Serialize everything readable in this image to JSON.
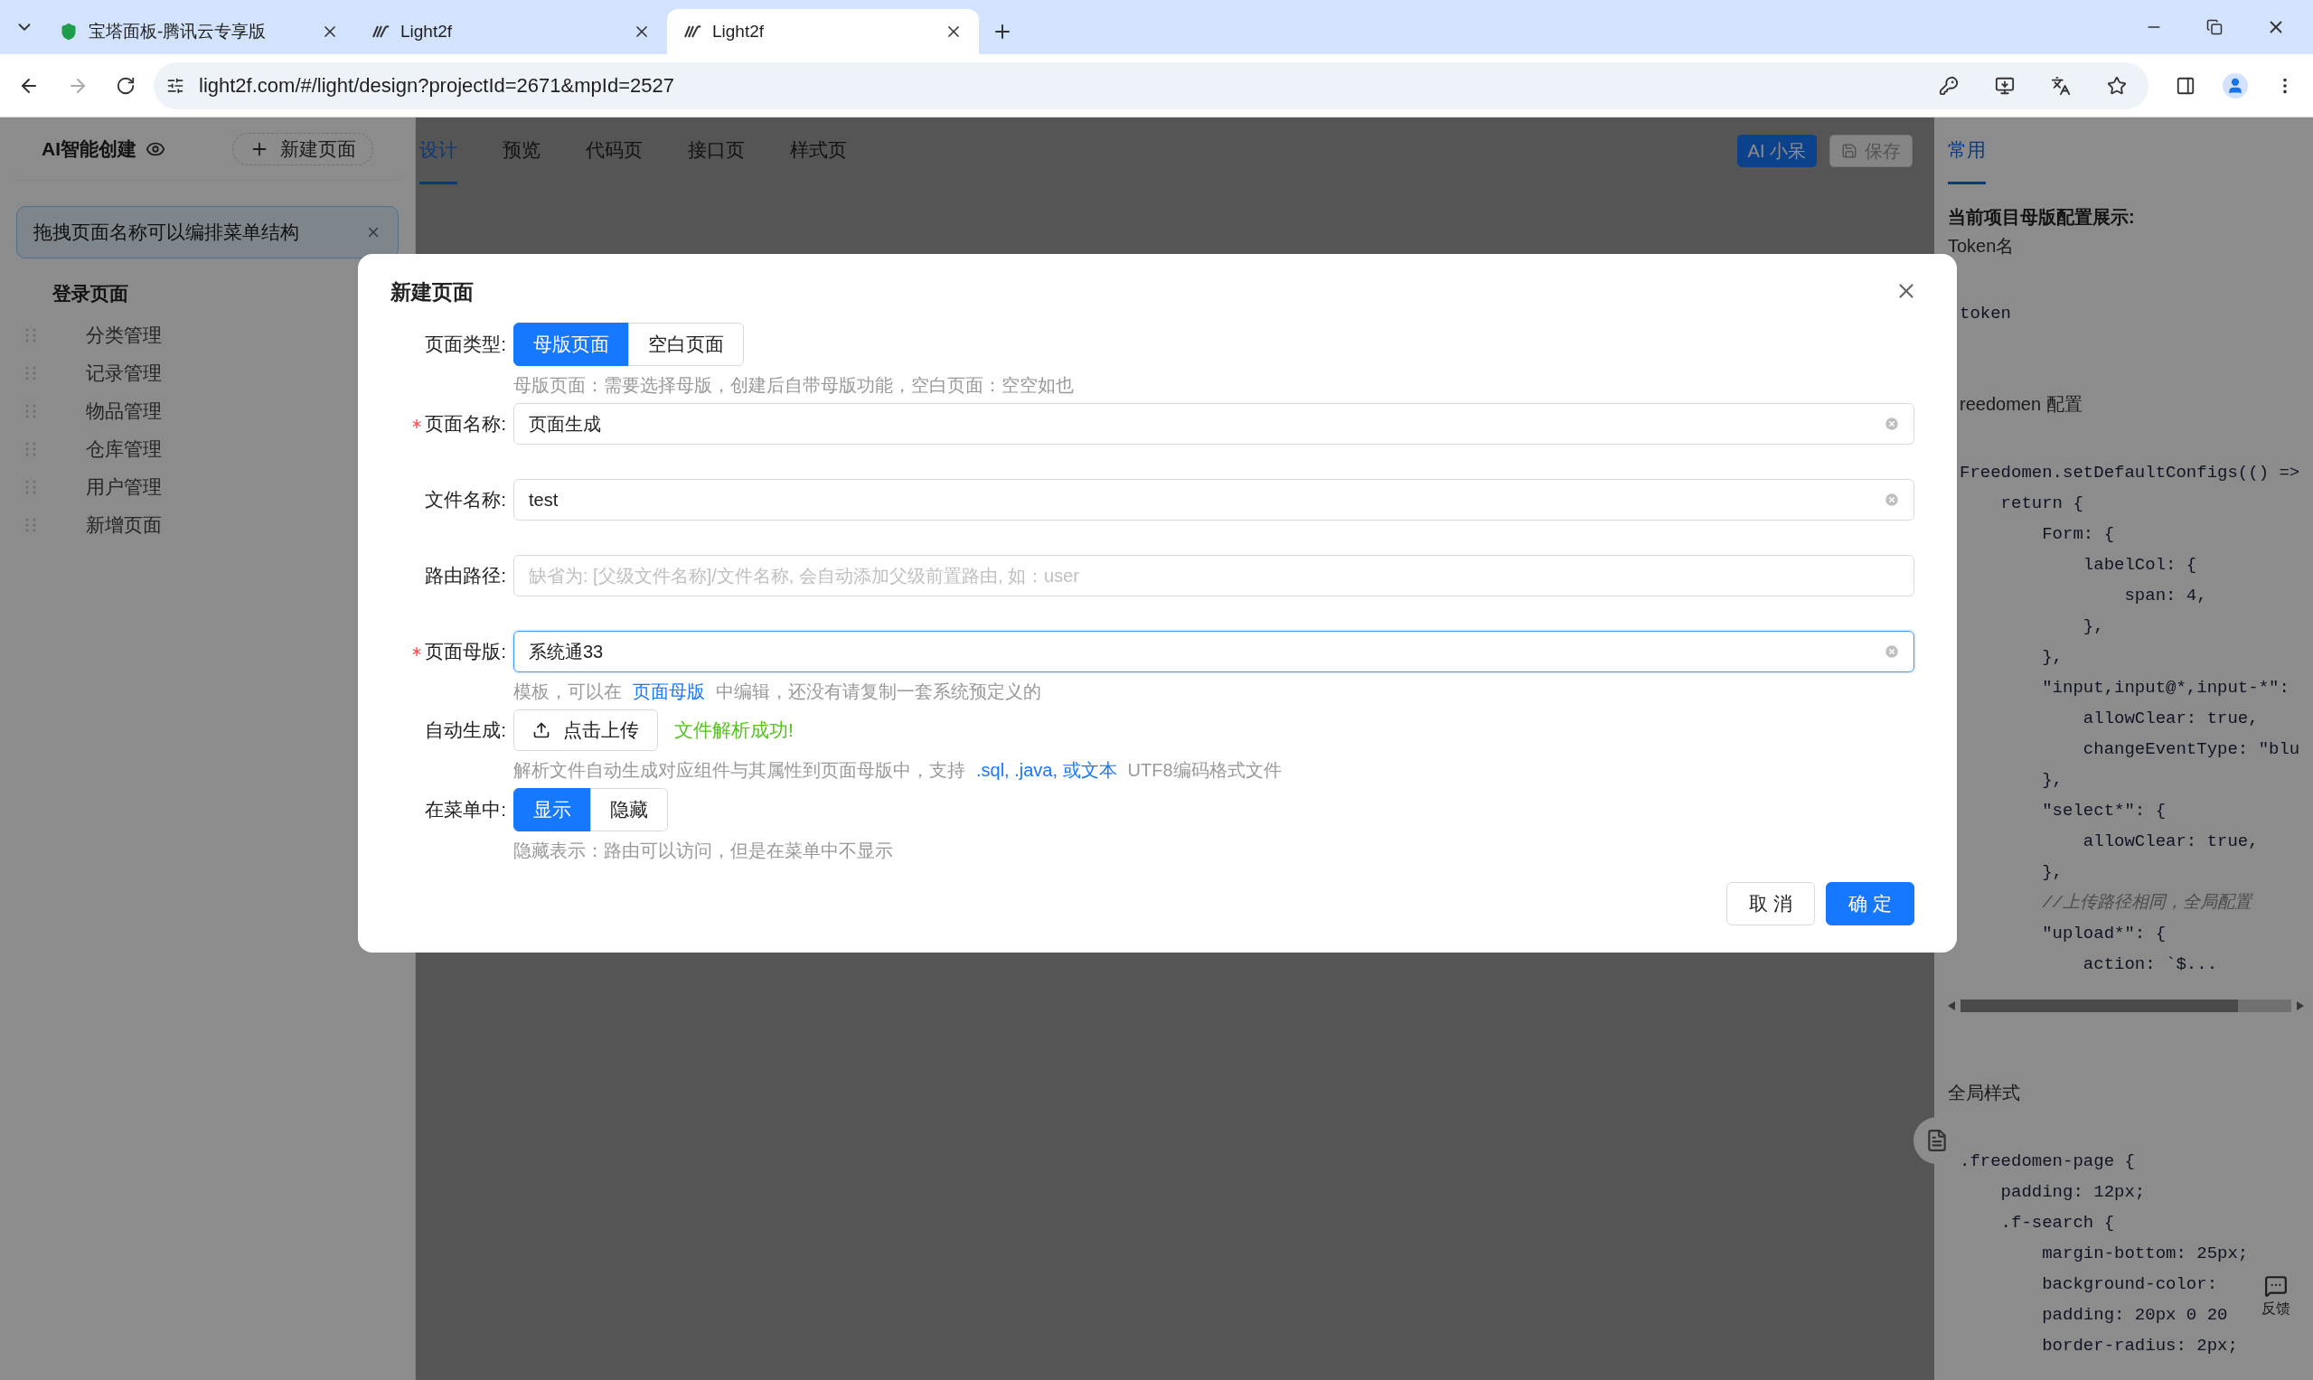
{
  "browser": {
    "tabs": [
      {
        "title": "宝塔面板-腾讯云专享版",
        "kind": "shield",
        "selected": false
      },
      {
        "title": "Light2f",
        "kind": "logo",
        "selected": false
      },
      {
        "title": "Light2f",
        "kind": "logo",
        "selected": true
      }
    ],
    "url": "light2f.com/#/light/design?projectId=2671&mpId=2527"
  },
  "sidebar": {
    "title": "AI智能创建",
    "new_page_button": "新建页面",
    "alert": "拖拽页面名称可以编排菜单结构",
    "group": "登录页面",
    "items": [
      "分类管理",
      "记录管理",
      "物品管理",
      "仓库管理",
      "用户管理",
      "新增页面"
    ]
  },
  "main": {
    "tabs": [
      {
        "label": "设计",
        "selected": true
      },
      {
        "label": "预览",
        "selected": false
      },
      {
        "label": "代码页",
        "selected": false
      },
      {
        "label": "接口页",
        "selected": false
      },
      {
        "label": "样式页",
        "selected": false
      }
    ],
    "ai_button": "AI 小呆",
    "save_button": {
      "label": "保存",
      "disabled": true
    }
  },
  "right_panel": {
    "tabs": [
      {
        "label": "常用",
        "selected": true
      }
    ],
    "heading": "当前项目母版配置展示:",
    "token_label": "Token名",
    "token_code": "token",
    "config_label": "reedomen 配置",
    "config_code": [
      {
        "text": "Freedomen.setDefaultConfigs(() =>",
        "kind": "code"
      },
      {
        "text": "    return {",
        "kind": "code"
      },
      {
        "text": "        Form: {",
        "kind": "code"
      },
      {
        "text": "            labelCol: {",
        "kind": "code"
      },
      {
        "text": "                span: 4,",
        "kind": "code"
      },
      {
        "text": "            },",
        "kind": "code"
      },
      {
        "text": "        },",
        "kind": "code"
      },
      {
        "text": "        \"input,input@*,input-*\":",
        "kind": "code"
      },
      {
        "text": "            allowClear: true,",
        "kind": "code"
      },
      {
        "text": "            changeEventType: \"blu",
        "kind": "code"
      },
      {
        "text": "        },",
        "kind": "code"
      },
      {
        "text": "        \"select*\": {",
        "kind": "code"
      },
      {
        "text": "            allowClear: true,",
        "kind": "code"
      },
      {
        "text": "        },",
        "kind": "code"
      },
      {
        "text": "        //上传路径相同，全局配置",
        "kind": "comment"
      },
      {
        "text": "        \"upload*\": {",
        "kind": "code"
      },
      {
        "text": "            action: `$...",
        "kind": "code"
      }
    ],
    "style_label": "全局样式",
    "style_code": [
      {
        "text": ".freedomen-page {",
        "kind": "code"
      },
      {
        "text": "    padding: 12px;",
        "kind": "code"
      },
      {
        "text": "    .f-search {",
        "kind": "code"
      },
      {
        "text": "        margin-bottom: 25px;",
        "kind": "code"
      },
      {
        "text": "        background-color:",
        "kind": "code"
      },
      {
        "text": "        padding: 20px 0 20",
        "kind": "code"
      },
      {
        "text": "        border-radius: 2px;",
        "kind": "code"
      }
    ],
    "feedback": "反馈"
  },
  "dialog": {
    "title": "新建页面",
    "fields": [
      {
        "kind": "segmented",
        "label": "页面类型:",
        "required": false,
        "options": [
          {
            "label": "母版页面",
            "selected": true
          },
          {
            "label": "空白页面",
            "selected": false
          }
        ],
        "hint": {
          "before": "母版页面：需要选择母版，创建后自带母版功能，空白页面：空空如也"
        }
      },
      {
        "kind": "input",
        "label": "页面名称:",
        "required": true,
        "value": "页面生成",
        "focused": false
      },
      {
        "kind": "input",
        "label": "文件名称:",
        "required": false,
        "value": "test",
        "focused": false
      },
      {
        "kind": "input",
        "label": "路由路径:",
        "required": false,
        "placeholder": "缺省为: [父级文件名称]/文件名称, 会自动添加父级前置路由, 如：user",
        "focused": false
      },
      {
        "kind": "input",
        "label": "页面母版:",
        "required": true,
        "value": "系统通33",
        "focused": true,
        "hint": {
          "before": "模板，可以在",
          "link": "页面母版",
          "after": "中编辑，还没有请复制一套系统预定义的"
        }
      },
      {
        "kind": "upload",
        "label": "自动生成:",
        "required": false,
        "button": "点击上传",
        "status": "文件解析成功!",
        "hint": {
          "before": "解析文件自动生成对应组件与其属性到页面母版中，支持",
          "link": ".sql, .java, 或文本",
          "after": "UTF8编码格式文件"
        }
      },
      {
        "kind": "segmented",
        "label": "在菜单中:",
        "required": false,
        "options": [
          {
            "label": "显示",
            "selected": true
          },
          {
            "label": "隐藏",
            "selected": false
          }
        ],
        "hint": {
          "before": "隐藏表示：路由可以访问，但是在菜单中不显示"
        }
      }
    ],
    "buttons": [
      {
        "label": "取 消",
        "primary": false
      },
      {
        "label": "确 定",
        "primary": true
      }
    ]
  }
}
